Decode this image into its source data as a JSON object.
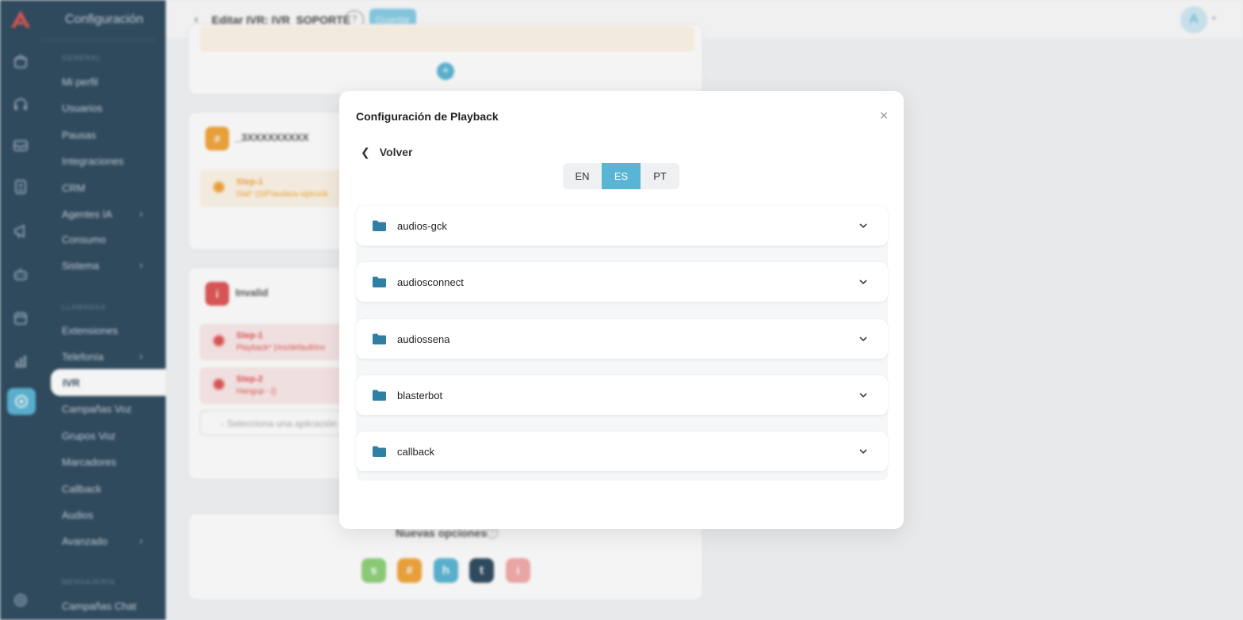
{
  "sidebar": {
    "title": "Configuración",
    "sections": [
      "GENERAL",
      "LLAMADAS",
      "MENSAJERÍA"
    ],
    "items": [
      {
        "label": "Mi perfil"
      },
      {
        "label": "Usuarios"
      },
      {
        "label": "Pausas"
      },
      {
        "label": "Integraciones"
      },
      {
        "label": "CRM"
      },
      {
        "label": "Agentes IA"
      },
      {
        "label": "Consumo"
      },
      {
        "label": "Sistema"
      },
      {
        "label": "Extensiones"
      },
      {
        "label": "Telefonía"
      },
      {
        "label": "IVR"
      },
      {
        "label": "Campañas Voz"
      },
      {
        "label": "Grupos Voz"
      },
      {
        "label": "Marcadores"
      },
      {
        "label": "Callback"
      },
      {
        "label": "Audios"
      },
      {
        "label": "Avanzado"
      },
      {
        "label": "Campañas Chat"
      }
    ]
  },
  "header": {
    "title": "Editar IVR: IVR_SOPORTE",
    "help": "?",
    "save_label": "Guardar",
    "avatar_initial": "A"
  },
  "background": {
    "card2": {
      "badge": "#",
      "title": "_3XXXXXXXXX",
      "step_title": "Step-1",
      "step_sub": "Dial* (SIP/audara-siptrunk"
    },
    "card3": {
      "badge": "i",
      "title": "Invalid",
      "step1_title": "Step-1",
      "step1_sub": "Playback* (/es/default/inv",
      "step2_title": "Step-2",
      "step2_sub": "Hangup - ()",
      "select_placeholder": "- Selecciona una aplicación"
    },
    "card4": {
      "label": "Nuevas opciones",
      "help": "?",
      "options": [
        "s",
        "#",
        "h",
        "t",
        "i"
      ]
    }
  },
  "modal": {
    "title": "Configuración de Playback",
    "close": "×",
    "back_label": "Volver",
    "languages": [
      {
        "code": "EN",
        "active": false
      },
      {
        "code": "ES",
        "active": true
      },
      {
        "code": "PT",
        "active": false
      }
    ],
    "folders": [
      {
        "name": "audios-gck"
      },
      {
        "name": "audiosconnect"
      },
      {
        "name": "audiossena"
      },
      {
        "name": "blasterbot"
      },
      {
        "name": "callback"
      }
    ]
  },
  "colors": {
    "accent": "#5ab5d4",
    "sidebar": "#2e4a5f",
    "folder_icon": "#2e7fa3"
  }
}
